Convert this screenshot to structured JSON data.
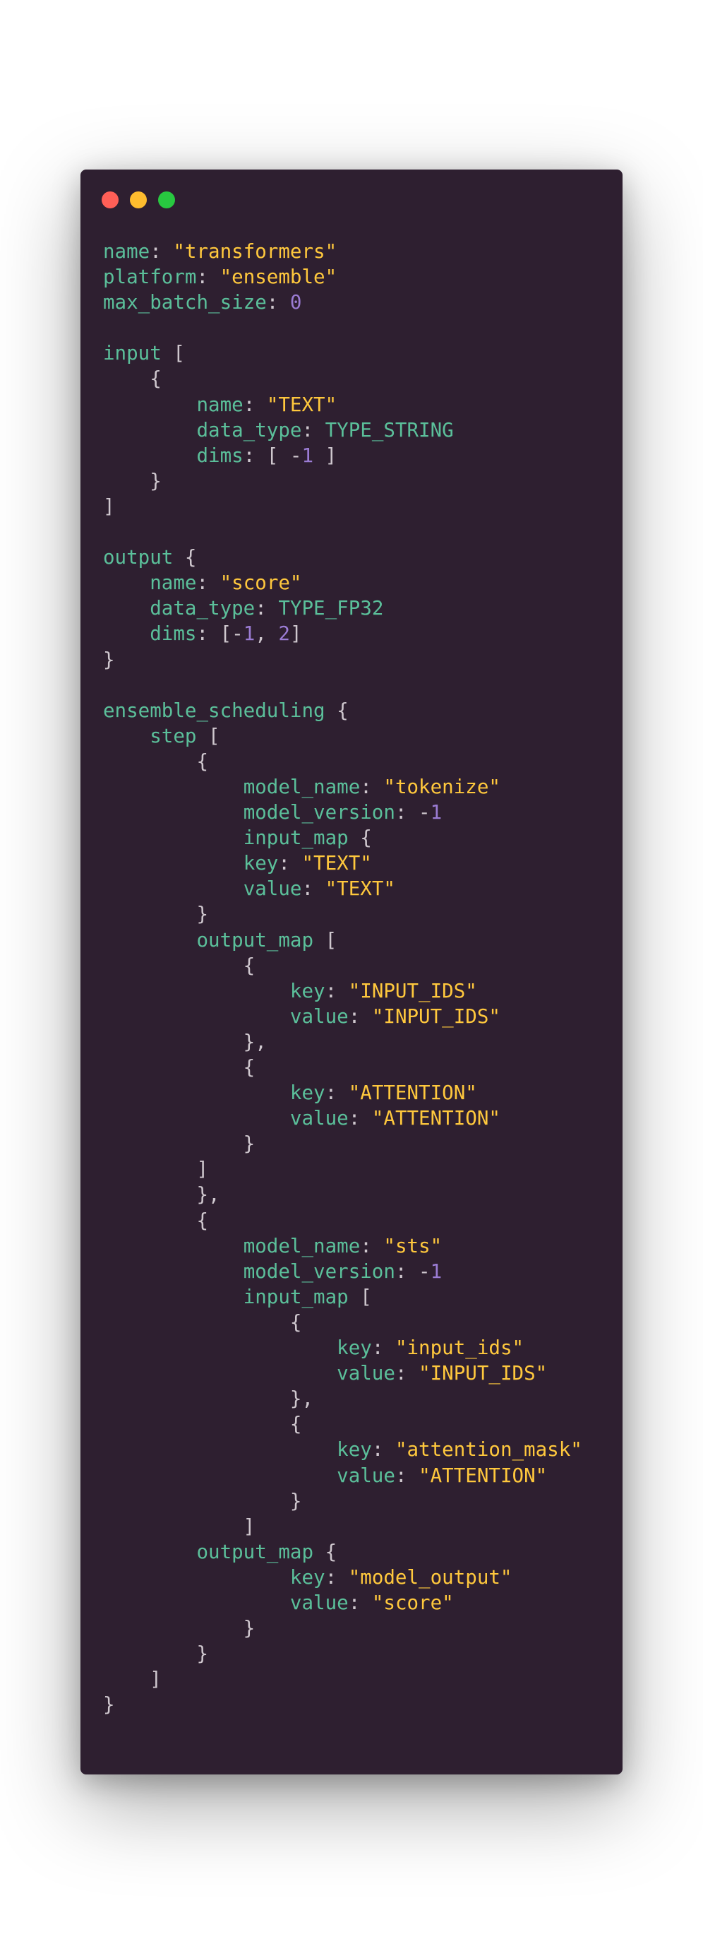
{
  "window": {
    "controls": [
      {
        "name": "close",
        "color": "#ff5f57"
      },
      {
        "name": "minimize",
        "color": "#febc2e"
      },
      {
        "name": "zoom",
        "color": "#28c840"
      }
    ]
  },
  "theme": {
    "background": "#2e1f30",
    "key_color": "#5bbf9a",
    "string_color": "#ffc83d",
    "number_color": "#9b7cd4",
    "punct_color": "#cfc7ce"
  },
  "code_lines": [
    [
      {
        "t": "k",
        "v": "name"
      },
      {
        "t": "p",
        "v": ": "
      },
      {
        "t": "s",
        "v": "\"transformers\""
      }
    ],
    [
      {
        "t": "k",
        "v": "platform"
      },
      {
        "t": "p",
        "v": ": "
      },
      {
        "t": "s",
        "v": "\"ensemble\""
      }
    ],
    [
      {
        "t": "k",
        "v": "max_batch_size"
      },
      {
        "t": "p",
        "v": ": "
      },
      {
        "t": "n",
        "v": "0"
      }
    ],
    [],
    [
      {
        "t": "k",
        "v": "input"
      },
      {
        "t": "p",
        "v": " ["
      }
    ],
    [
      {
        "t": "p",
        "v": "    {"
      }
    ],
    [
      {
        "t": "p",
        "v": "        "
      },
      {
        "t": "k",
        "v": "name"
      },
      {
        "t": "p",
        "v": ": "
      },
      {
        "t": "s",
        "v": "\"TEXT\""
      }
    ],
    [
      {
        "t": "p",
        "v": "        "
      },
      {
        "t": "k",
        "v": "data_type"
      },
      {
        "t": "p",
        "v": ": "
      },
      {
        "t": "k",
        "v": "TYPE_STRING"
      }
    ],
    [
      {
        "t": "p",
        "v": "        "
      },
      {
        "t": "k",
        "v": "dims"
      },
      {
        "t": "p",
        "v": ": [ -"
      },
      {
        "t": "n",
        "v": "1"
      },
      {
        "t": "p",
        "v": " ]"
      }
    ],
    [
      {
        "t": "p",
        "v": "    }"
      }
    ],
    [
      {
        "t": "p",
        "v": "]"
      }
    ],
    [],
    [
      {
        "t": "k",
        "v": "output"
      },
      {
        "t": "p",
        "v": " {"
      }
    ],
    [
      {
        "t": "p",
        "v": "    "
      },
      {
        "t": "k",
        "v": "name"
      },
      {
        "t": "p",
        "v": ": "
      },
      {
        "t": "s",
        "v": "\"score\""
      }
    ],
    [
      {
        "t": "p",
        "v": "    "
      },
      {
        "t": "k",
        "v": "data_type"
      },
      {
        "t": "p",
        "v": ": "
      },
      {
        "t": "k",
        "v": "TYPE_FP32"
      }
    ],
    [
      {
        "t": "p",
        "v": "    "
      },
      {
        "t": "k",
        "v": "dims"
      },
      {
        "t": "p",
        "v": ": [-"
      },
      {
        "t": "n",
        "v": "1"
      },
      {
        "t": "p",
        "v": ", "
      },
      {
        "t": "n",
        "v": "2"
      },
      {
        "t": "p",
        "v": "]"
      }
    ],
    [
      {
        "t": "p",
        "v": "}"
      }
    ],
    [],
    [
      {
        "t": "k",
        "v": "ensemble_scheduling"
      },
      {
        "t": "p",
        "v": " {"
      }
    ],
    [
      {
        "t": "p",
        "v": "    "
      },
      {
        "t": "k",
        "v": "step"
      },
      {
        "t": "p",
        "v": " ["
      }
    ],
    [
      {
        "t": "p",
        "v": "        {"
      }
    ],
    [
      {
        "t": "p",
        "v": "            "
      },
      {
        "t": "k",
        "v": "model_name"
      },
      {
        "t": "p",
        "v": ": "
      },
      {
        "t": "s",
        "v": "\"tokenize\""
      }
    ],
    [
      {
        "t": "p",
        "v": "            "
      },
      {
        "t": "k",
        "v": "model_version"
      },
      {
        "t": "p",
        "v": ": -"
      },
      {
        "t": "n",
        "v": "1"
      }
    ],
    [
      {
        "t": "p",
        "v": "            "
      },
      {
        "t": "k",
        "v": "input_map"
      },
      {
        "t": "p",
        "v": " {"
      }
    ],
    [
      {
        "t": "p",
        "v": "            "
      },
      {
        "t": "k",
        "v": "key"
      },
      {
        "t": "p",
        "v": ": "
      },
      {
        "t": "s",
        "v": "\"TEXT\""
      }
    ],
    [
      {
        "t": "p",
        "v": "            "
      },
      {
        "t": "k",
        "v": "value"
      },
      {
        "t": "p",
        "v": ": "
      },
      {
        "t": "s",
        "v": "\"TEXT\""
      }
    ],
    [
      {
        "t": "p",
        "v": "        }"
      }
    ],
    [
      {
        "t": "p",
        "v": "        "
      },
      {
        "t": "k",
        "v": "output_map"
      },
      {
        "t": "p",
        "v": " ["
      }
    ],
    [
      {
        "t": "p",
        "v": "            {"
      }
    ],
    [
      {
        "t": "p",
        "v": "                "
      },
      {
        "t": "k",
        "v": "key"
      },
      {
        "t": "p",
        "v": ": "
      },
      {
        "t": "s",
        "v": "\"INPUT_IDS\""
      }
    ],
    [
      {
        "t": "p",
        "v": "                "
      },
      {
        "t": "k",
        "v": "value"
      },
      {
        "t": "p",
        "v": ": "
      },
      {
        "t": "s",
        "v": "\"INPUT_IDS\""
      }
    ],
    [
      {
        "t": "p",
        "v": "            },"
      }
    ],
    [
      {
        "t": "p",
        "v": "            {"
      }
    ],
    [
      {
        "t": "p",
        "v": "                "
      },
      {
        "t": "k",
        "v": "key"
      },
      {
        "t": "p",
        "v": ": "
      },
      {
        "t": "s",
        "v": "\"ATTENTION\""
      }
    ],
    [
      {
        "t": "p",
        "v": "                "
      },
      {
        "t": "k",
        "v": "value"
      },
      {
        "t": "p",
        "v": ": "
      },
      {
        "t": "s",
        "v": "\"ATTENTION\""
      }
    ],
    [
      {
        "t": "p",
        "v": "            }"
      }
    ],
    [
      {
        "t": "p",
        "v": "        ]"
      }
    ],
    [
      {
        "t": "p",
        "v": "        },"
      }
    ],
    [
      {
        "t": "p",
        "v": "        {"
      }
    ],
    [
      {
        "t": "p",
        "v": "            "
      },
      {
        "t": "k",
        "v": "model_name"
      },
      {
        "t": "p",
        "v": ": "
      },
      {
        "t": "s",
        "v": "\"sts\""
      }
    ],
    [
      {
        "t": "p",
        "v": "            "
      },
      {
        "t": "k",
        "v": "model_version"
      },
      {
        "t": "p",
        "v": ": -"
      },
      {
        "t": "n",
        "v": "1"
      }
    ],
    [
      {
        "t": "p",
        "v": "            "
      },
      {
        "t": "k",
        "v": "input_map"
      },
      {
        "t": "p",
        "v": " ["
      }
    ],
    [
      {
        "t": "p",
        "v": "                {"
      }
    ],
    [
      {
        "t": "p",
        "v": "                    "
      },
      {
        "t": "k",
        "v": "key"
      },
      {
        "t": "p",
        "v": ": "
      },
      {
        "t": "s",
        "v": "\"input_ids\""
      }
    ],
    [
      {
        "t": "p",
        "v": "                    "
      },
      {
        "t": "k",
        "v": "value"
      },
      {
        "t": "p",
        "v": ": "
      },
      {
        "t": "s",
        "v": "\"INPUT_IDS\""
      }
    ],
    [
      {
        "t": "p",
        "v": "                },"
      }
    ],
    [
      {
        "t": "p",
        "v": "                {"
      }
    ],
    [
      {
        "t": "p",
        "v": "                    "
      },
      {
        "t": "k",
        "v": "key"
      },
      {
        "t": "p",
        "v": ": "
      },
      {
        "t": "s",
        "v": "\"attention_mask\""
      }
    ],
    [
      {
        "t": "p",
        "v": "                    "
      },
      {
        "t": "k",
        "v": "value"
      },
      {
        "t": "p",
        "v": ": "
      },
      {
        "t": "s",
        "v": "\"ATTENTION\""
      }
    ],
    [
      {
        "t": "p",
        "v": "                }"
      }
    ],
    [
      {
        "t": "p",
        "v": "            ]"
      }
    ],
    [
      {
        "t": "p",
        "v": "        "
      },
      {
        "t": "k",
        "v": "output_map"
      },
      {
        "t": "p",
        "v": " {"
      }
    ],
    [
      {
        "t": "p",
        "v": "                "
      },
      {
        "t": "k",
        "v": "key"
      },
      {
        "t": "p",
        "v": ": "
      },
      {
        "t": "s",
        "v": "\"model_output\""
      }
    ],
    [
      {
        "t": "p",
        "v": "                "
      },
      {
        "t": "k",
        "v": "value"
      },
      {
        "t": "p",
        "v": ": "
      },
      {
        "t": "s",
        "v": "\"score\""
      }
    ],
    [
      {
        "t": "p",
        "v": "            }"
      }
    ],
    [
      {
        "t": "p",
        "v": "        }"
      }
    ],
    [
      {
        "t": "p",
        "v": "    ]"
      }
    ],
    [
      {
        "t": "p",
        "v": "}"
      }
    ]
  ]
}
